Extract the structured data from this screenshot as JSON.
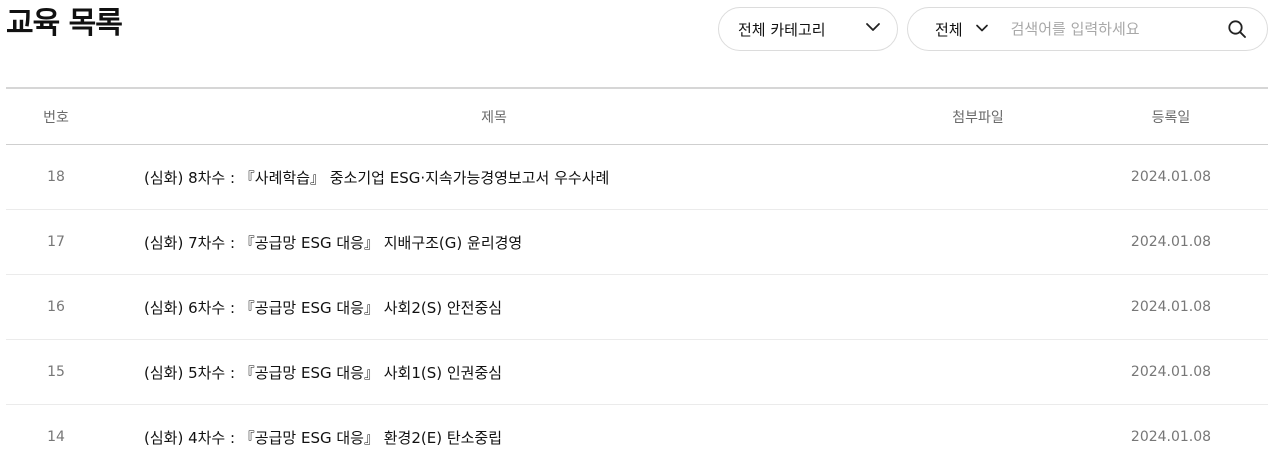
{
  "header": {
    "title": "교육 목록"
  },
  "filters": {
    "category_label": "전체 카테고리",
    "scope_label": "전체",
    "search_placeholder": "검색어를 입력하세요"
  },
  "table": {
    "columns": {
      "no": "번호",
      "title": "제목",
      "file": "첨부파일",
      "date": "등록일"
    },
    "rows": [
      {
        "no": "18",
        "title": "(심화) 8차수 : 『사례학습』 중소기업 ESG·지속가능경영보고서 우수사례",
        "file": "",
        "date": "2024.01.08"
      },
      {
        "no": "17",
        "title": "(심화) 7차수 : 『공급망 ESG 대응』 지배구조(G) 윤리경영",
        "file": "",
        "date": "2024.01.08"
      },
      {
        "no": "16",
        "title": "(심화) 6차수 : 『공급망 ESG 대응』 사회2(S) 안전중심",
        "file": "",
        "date": "2024.01.08"
      },
      {
        "no": "15",
        "title": "(심화) 5차수 : 『공급망 ESG 대응』 사회1(S) 인권중심",
        "file": "",
        "date": "2024.01.08"
      },
      {
        "no": "14",
        "title": "(심화) 4차수 : 『공급망 ESG 대응』 환경2(E) 탄소중립",
        "file": "",
        "date": "2024.01.08"
      }
    ]
  },
  "icons": {
    "category_chevron": "chevron-down-icon",
    "scope_chevron": "chevron-down-icon",
    "search": "search-icon"
  }
}
